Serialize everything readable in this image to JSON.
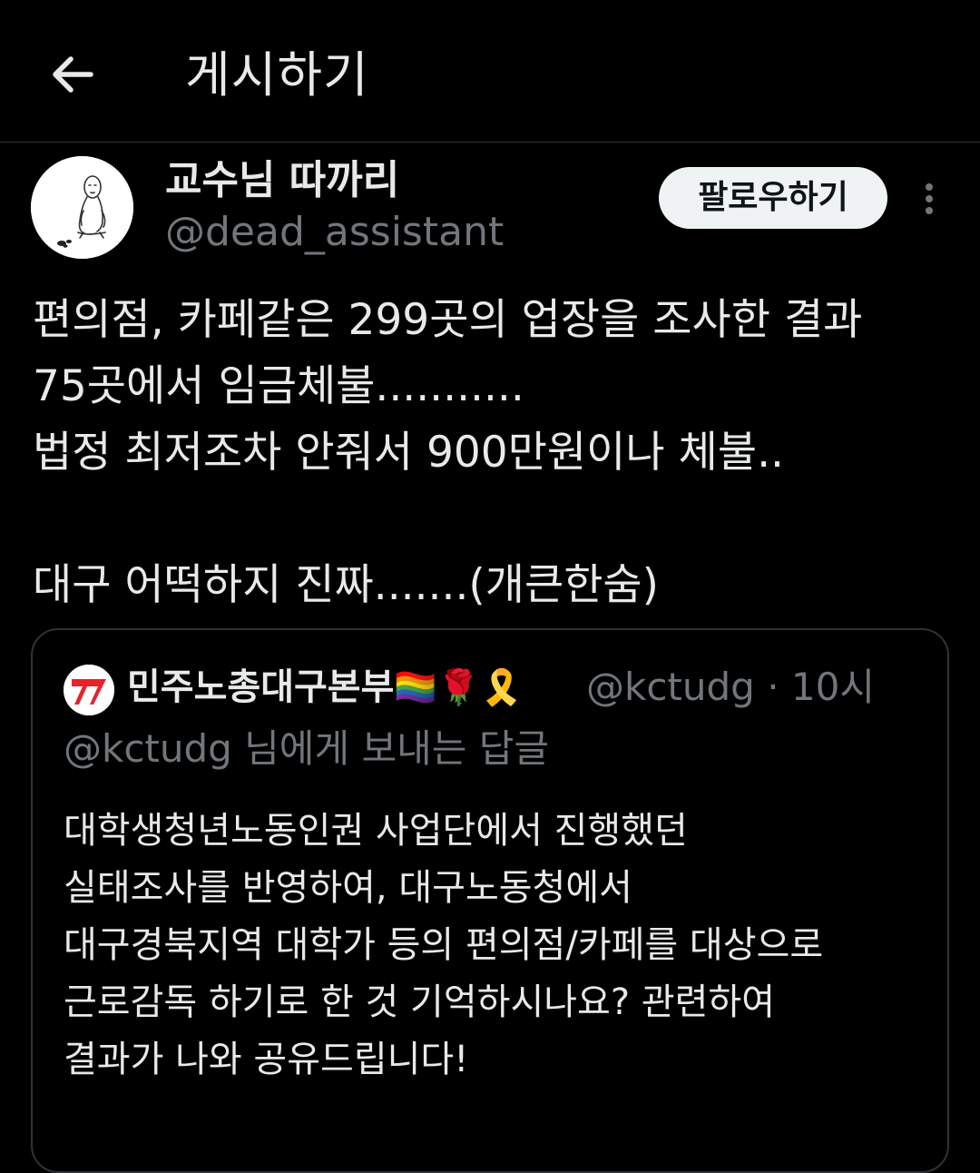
{
  "header": {
    "title": "게시하기"
  },
  "author": {
    "name": "교수님 따까리",
    "handle": "@dead_assistant"
  },
  "follow_button": {
    "label": "팔로우하기"
  },
  "tweet": {
    "text": "편의점, 카페같은 299곳의 업장을 조사한 결과\n75곳에서 임금체불...........\n법정 최저조차 안줘서 900만원이나 체불..\n\n대구 어떡하지 진짜.......(개큰한숨)"
  },
  "quote": {
    "name": "민주노총대구본부",
    "emojis": "🏳️‍🌈🌹🎗️",
    "handle": "@kctudg",
    "separator": "·",
    "time": "10시",
    "replying_to": "@kctudg 님에게 보내는 답글",
    "text": "대학생청년노동인권 사업단에서 진행했던\n실태조사를 반영하여, 대구노동청에서\n대구경북지역 대학가 등의 편의점/카페를 대상으로\n근로감독 하기로 한 것 기억하시나요? 관련하여\n결과가 나와 공유드립니다!"
  },
  "colors": {
    "background": "#000000",
    "text_primary": "#e7e9ea",
    "text_secondary": "#71767b",
    "border": "#2f3336",
    "follow_button_bg": "#eff3f4",
    "quote_logo_red": "#e8222b"
  },
  "icons": {
    "back": "arrow-left-icon",
    "more": "more-vertical-icon"
  }
}
